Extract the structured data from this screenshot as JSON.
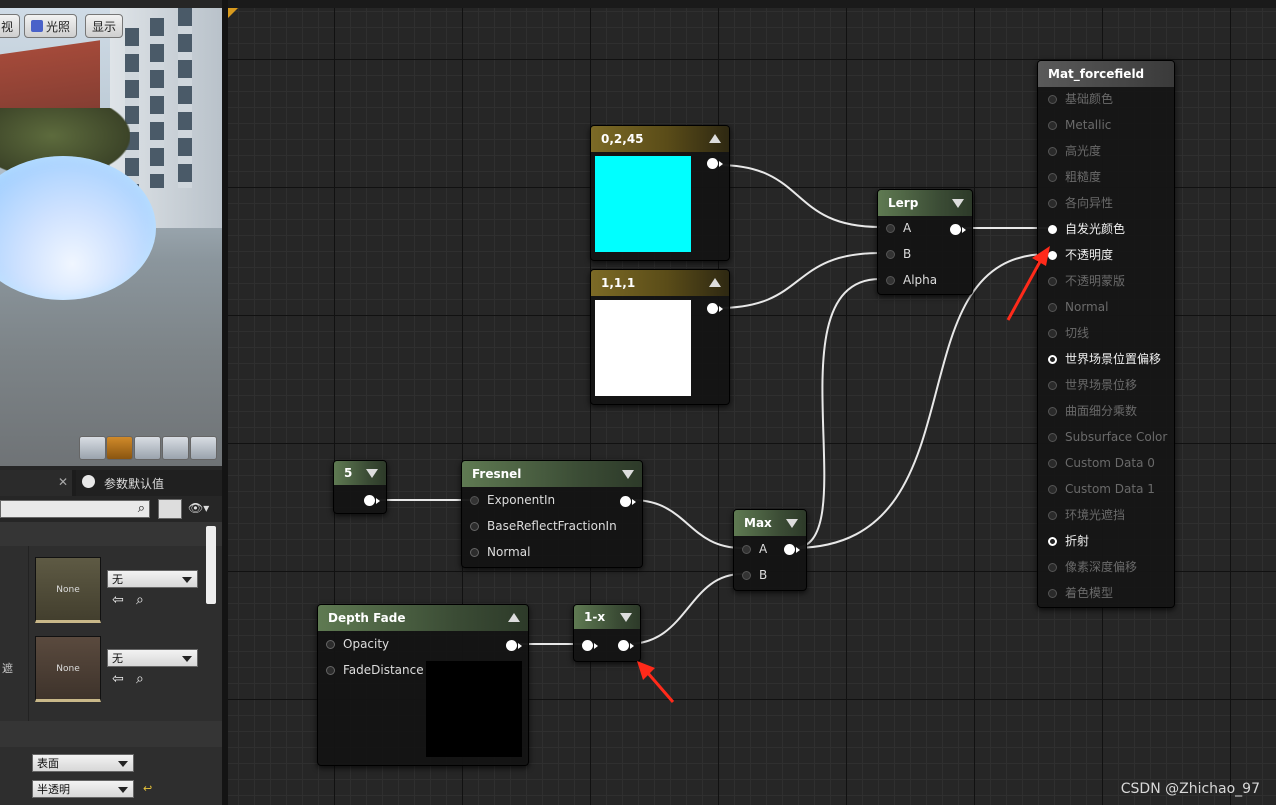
{
  "viewport": {
    "buttons": [
      {
        "label": "视"
      },
      {
        "label": "光照"
      },
      {
        "label": "显示"
      }
    ],
    "bottom_icons": [
      "cylinder-icon",
      "sphere-icon",
      "plane-icon",
      "cube-icon",
      "teapot-icon"
    ]
  },
  "details_panel": {
    "tab_label": "参数默认值",
    "params": [
      {
        "texture_label": "None",
        "dropdown": "无"
      },
      {
        "texture_label": "None",
        "dropdown": "无"
      }
    ],
    "side_label": "遮",
    "domain_dropdown": "表面",
    "blend_dropdown": "半透明"
  },
  "graph": {
    "nodes": {
      "color_a": {
        "title": "0,2,45",
        "swatch": "#00ffff"
      },
      "color_b": {
        "title": "1,1,1",
        "swatch": "#ffffff"
      },
      "lerp": {
        "title": "Lerp",
        "pins": [
          "A",
          "B",
          "Alpha"
        ]
      },
      "const5": {
        "title": "5"
      },
      "fresnel": {
        "title": "Fresnel",
        "pins": [
          "ExponentIn",
          "BaseReflectFractionIn",
          "Normal"
        ]
      },
      "max": {
        "title": "Max",
        "pins": [
          "A",
          "B"
        ]
      },
      "depth_fade": {
        "title": "Depth Fade",
        "pins": [
          "Opacity",
          "FadeDistance"
        ]
      },
      "one_minus": {
        "title": "1-x"
      }
    },
    "material": {
      "title": "Mat_forcefield",
      "pins": [
        {
          "label": "基础颜色",
          "state": "disabled"
        },
        {
          "label": "Metallic",
          "state": "disabled"
        },
        {
          "label": "高光度",
          "state": "disabled"
        },
        {
          "label": "粗糙度",
          "state": "disabled"
        },
        {
          "label": "各向异性",
          "state": "disabled"
        },
        {
          "label": "自发光颜色",
          "state": "connected"
        },
        {
          "label": "不透明度",
          "state": "connected"
        },
        {
          "label": "不透明蒙版",
          "state": "disabled"
        },
        {
          "label": "Normal",
          "state": "disabled"
        },
        {
          "label": "切线",
          "state": "disabled"
        },
        {
          "label": "世界场景位置偏移",
          "state": "enabled"
        },
        {
          "label": "世界场景位移",
          "state": "disabled"
        },
        {
          "label": "曲面细分乘数",
          "state": "disabled"
        },
        {
          "label": "Subsurface Color",
          "state": "disabled"
        },
        {
          "label": "Custom Data 0",
          "state": "disabled"
        },
        {
          "label": "Custom Data 1",
          "state": "disabled"
        },
        {
          "label": "环境光遮挡",
          "state": "disabled"
        },
        {
          "label": "折射",
          "state": "enabled"
        },
        {
          "label": "像素深度偏移",
          "state": "disabled"
        },
        {
          "label": "着色模型",
          "state": "disabled"
        }
      ]
    }
  },
  "watermark": "CSDN @Zhichao_97",
  "colors": {
    "annotation_arrow": "#ff2a1a",
    "accent": "#d89a1e"
  }
}
